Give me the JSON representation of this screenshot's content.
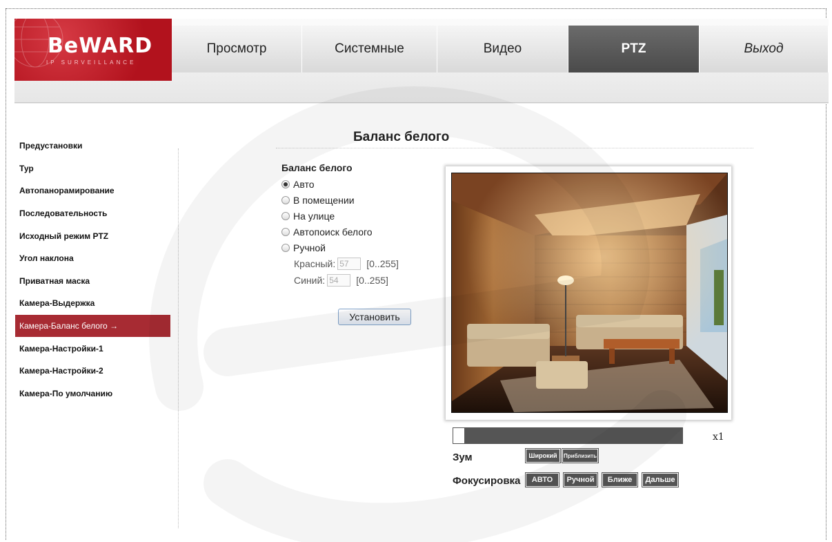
{
  "header": {
    "brand": "BeWARD",
    "brand_sub": "IP SURVEILLANCE",
    "nav": [
      {
        "label": "Просмотр",
        "active": false
      },
      {
        "label": "Системные",
        "active": false
      },
      {
        "label": "Видео",
        "active": false
      },
      {
        "label": "PTZ",
        "active": true
      },
      {
        "label": "Выход",
        "active": false
      }
    ]
  },
  "sidebar": {
    "items": [
      "Предустановки",
      "Тур",
      "Автопанорамирование",
      "Последовательность",
      "Исходный режим PTZ",
      "Угол наклона",
      "Приватная маска",
      "Камера-Выдержка",
      "Камера-Баланс белого",
      "Камера-Настройки-1",
      "Камера-Настройки-2",
      "Камера-По умолчанию"
    ],
    "active_index": 8,
    "active_arrow": "→"
  },
  "page_title": "Баланс белого",
  "form": {
    "header": "Баланс белого",
    "options": [
      "Авто",
      "В помещении",
      "На улице",
      "Автопоиск белого",
      "Ручной"
    ],
    "selected": "Авто",
    "red_label": "Красный:",
    "red_value": "57",
    "red_range": "[0..255]",
    "blue_label": "Синий:",
    "blue_value": "54",
    "blue_range": "[0..255]",
    "set_button": "Установить"
  },
  "ptz": {
    "zoom_value": "x1",
    "zoom_level": 0,
    "zoom_label": "Зум",
    "zoom_wide": "Широкий",
    "zoom_tele": "Приблизить",
    "focus_label": "Фокусировка",
    "focus_auto": "АВТО",
    "focus_manual": "Ручной",
    "focus_near": "Ближе",
    "focus_far": "Дальше"
  },
  "colors": {
    "accent": "#a72b33",
    "active_tab": "#555555",
    "control_button": "#555555"
  }
}
